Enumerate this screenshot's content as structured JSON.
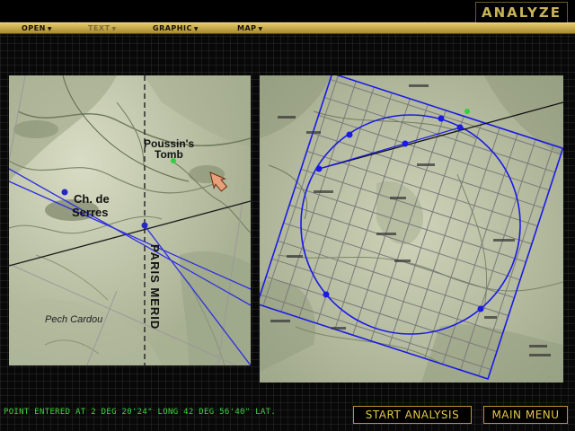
{
  "app": {
    "title": "ANALYZE"
  },
  "menu": [
    {
      "label": "OPEN",
      "enabled": true
    },
    {
      "label": "TEXT",
      "enabled": false
    },
    {
      "label": "GRAPHIC",
      "enabled": true
    },
    {
      "label": "MAP",
      "enabled": true
    }
  ],
  "left_map": {
    "labels": {
      "poussin": "Poussin's",
      "tomb": "Tomb",
      "serres_1": "Ch. de",
      "serres_2": "Serres",
      "meridian": "PARIS MERID",
      "pech": "Pech Cardou"
    }
  },
  "status": {
    "message": "POINT ENTERED AT 2 DEG 20'24\" LONG  42 DEG 56'40\" LAT."
  },
  "buttons": {
    "start_analysis": "START ANALYSIS",
    "main_menu": "MAIN MENU"
  },
  "colors": {
    "accent_gold": "#e6c64a",
    "status_green": "#3dd23d",
    "overlay_blue": "#1a1ae6",
    "map_bg": "#c7cdb2"
  },
  "icons": {
    "cursor": "arrow-cursor-icon",
    "menu_dropdown": "chevron-down-icon"
  }
}
